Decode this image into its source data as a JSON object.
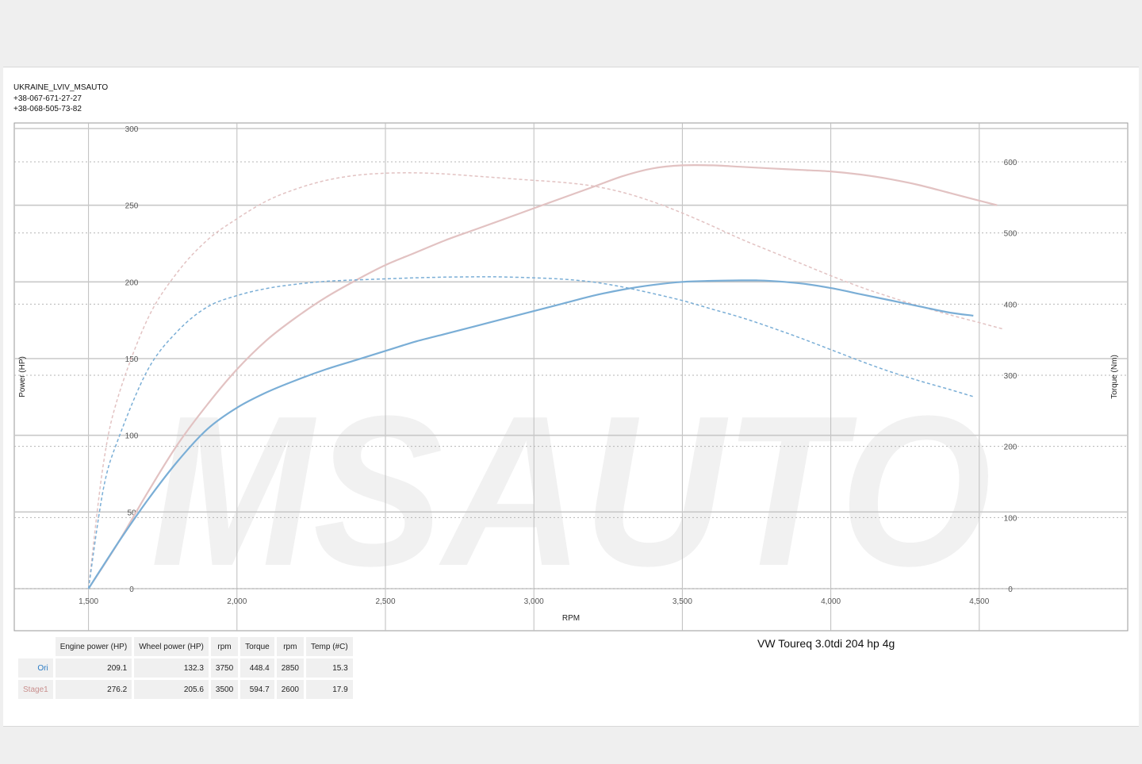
{
  "header": {
    "line1": "UKRAINE_LVIV_MSAUTO",
    "line2": "+38-067-671-27-27",
    "line3": "+38-068-505-73-82"
  },
  "watermark": "MSAUTO",
  "car_title": "VW Toureq 3.0tdi 204 hp 4g",
  "colors": {
    "ori": "#7aaed6",
    "stage1": "#e2c2c2",
    "grid": "#c8c8c8"
  },
  "summary": {
    "headers": [
      "Engine power (HP)",
      "Wheel power (HP)",
      "rpm",
      "Torque",
      "rpm",
      "Temp (#C)"
    ],
    "rows": [
      {
        "label": "Ori",
        "color": "#2a7bc4",
        "values": [
          "209.1",
          "132.3",
          "3750",
          "448.4",
          "2850",
          "15.3"
        ]
      },
      {
        "label": "Stage1",
        "color": "#c9908e",
        "values": [
          "276.2",
          "205.6",
          "3500",
          "594.7",
          "2600",
          "17.9"
        ]
      }
    ]
  },
  "chart_data": {
    "type": "line",
    "xlabel": "RPM",
    "ylabel": "Power (HP)",
    "y2label": "Torque (Nm)",
    "x_ticks": [
      "1,500",
      "2,000",
      "2,500",
      "3,000",
      "3,500",
      "4,000",
      "4,500"
    ],
    "y_ticks": [
      "0",
      "50",
      "100",
      "150",
      "200",
      "250",
      "300"
    ],
    "y2_ticks": [
      "0",
      "100",
      "200",
      "300",
      "400",
      "500",
      "600"
    ],
    "xlim": [
      1250,
      5000
    ],
    "ylim": [
      0,
      300
    ],
    "y2lim": [
      0,
      600
    ],
    "grid": true,
    "series": [
      {
        "name": "Ori",
        "kind": "power",
        "axis": "left",
        "style": "solid",
        "color": "#7aaed6",
        "x": [
          1500,
          1600,
          1700,
          1800,
          1900,
          2000,
          2100,
          2200,
          2300,
          2400,
          2500,
          2600,
          2700,
          2800,
          2900,
          3000,
          3100,
          3200,
          3300,
          3400,
          3500,
          3600,
          3700,
          3750,
          3800,
          3900,
          4000,
          4100,
          4200,
          4300,
          4400,
          4480
        ],
        "y": [
          0,
          30,
          58,
          83,
          104,
          118,
          128,
          136,
          143,
          149,
          155,
          161,
          166,
          171,
          176,
          181,
          186,
          191,
          195,
          198,
          200,
          200.7,
          201,
          201,
          200.6,
          199,
          196,
          192,
          188,
          184,
          180,
          178
        ]
      },
      {
        "name": "Stage1",
        "kind": "power",
        "axis": "left",
        "style": "solid",
        "color": "#e2c2c2",
        "x": [
          1500,
          1600,
          1700,
          1800,
          1900,
          2000,
          2100,
          2200,
          2300,
          2400,
          2500,
          2600,
          2700,
          2800,
          2900,
          3000,
          3100,
          3200,
          3300,
          3400,
          3500,
          3600,
          3700,
          3800,
          3900,
          4000,
          4100,
          4200,
          4300,
          4400,
          4500,
          4560
        ],
        "y": [
          0,
          30,
          63,
          94,
          120,
          143,
          162,
          177,
          190,
          201,
          211,
          219,
          227,
          234,
          241,
          248,
          255,
          262,
          269,
          274,
          276,
          276,
          275,
          274,
          273,
          272,
          270,
          267,
          263,
          258,
          253,
          250
        ]
      },
      {
        "name": "Ori",
        "kind": "torque",
        "axis": "right",
        "style": "dashed",
        "color": "#7aaed6",
        "x": [
          1500,
          1550,
          1600,
          1700,
          1800,
          1900,
          2000,
          2100,
          2200,
          2300,
          2400,
          2500,
          2600,
          2700,
          2800,
          2850,
          2900,
          3000,
          3100,
          3200,
          3300,
          3400,
          3500,
          3600,
          3700,
          3800,
          3900,
          4000,
          4100,
          4200,
          4300,
          4400,
          4480
        ],
        "y": [
          0,
          140,
          210,
          308,
          362,
          396,
          412,
          422,
          428,
          432,
          434,
          435.5,
          437,
          437.9,
          438.4,
          438.4,
          438.2,
          437,
          435,
          431,
          424,
          415,
          405,
          393,
          381,
          367,
          352,
          336,
          320,
          305,
          292,
          280,
          270
        ]
      },
      {
        "name": "Stage1",
        "kind": "torque",
        "axis": "right",
        "style": "dashed",
        "color": "#e2c2c2",
        "x": [
          1500,
          1550,
          1600,
          1700,
          1800,
          1900,
          2000,
          2100,
          2200,
          2300,
          2400,
          2500,
          2600,
          2700,
          2800,
          2900,
          3000,
          3100,
          3200,
          3300,
          3400,
          3500,
          3600,
          3700,
          3800,
          3900,
          4000,
          4100,
          4200,
          4300,
          4400,
          4500,
          4580
        ],
        "y": [
          0,
          175,
          270,
          380,
          445,
          490,
          520,
          545,
          562,
          574,
          581,
          584,
          584.5,
          583,
          580,
          577,
          574,
          571,
          566,
          557,
          544,
          528,
          510,
          491,
          474,
          457,
          440,
          424,
          410,
          397,
          385,
          374,
          365
        ]
      }
    ]
  }
}
